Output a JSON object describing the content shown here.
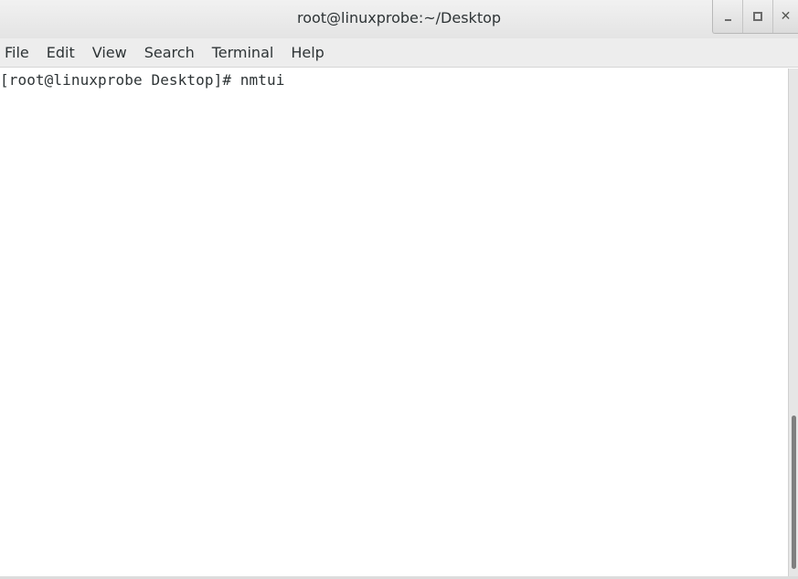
{
  "window": {
    "title": "root@linuxprobe:~/Desktop",
    "controls": {
      "minimize_label": "_",
      "maximize_label": "□",
      "close_label": "✕"
    }
  },
  "menubar": {
    "items": [
      {
        "label": "File"
      },
      {
        "label": "Edit"
      },
      {
        "label": "View"
      },
      {
        "label": "Search"
      },
      {
        "label": "Terminal"
      },
      {
        "label": "Help"
      }
    ]
  },
  "terminal": {
    "lines": [
      "[root@linuxprobe Desktop]# nmtui"
    ]
  }
}
